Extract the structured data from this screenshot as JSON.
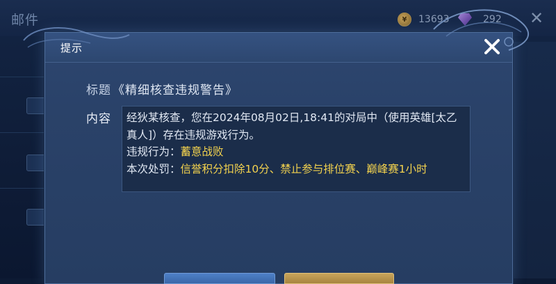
{
  "background": {
    "title": "邮件",
    "gold_amount": "13693",
    "gem_amount": "292"
  },
  "dialog": {
    "title": "提示",
    "subject_label": "标题",
    "subject": "《精细核查违规警告》",
    "content_label": "内容",
    "content": {
      "line1": "经狄某核查，您在2024年08月02日,18:41的对局中（使用英雄[太乙真人]）存在违规游戏行为。",
      "violation_label": "违规行为：",
      "violation_value": "蓄意战败",
      "penalty_label": "本次处罚：",
      "penalty_value": "信誉积分扣除10分、禁止参与排位赛、巅峰赛1小时"
    }
  },
  "colors": {
    "highlight": "#f3d24e",
    "dialog_bg": "#2a4269",
    "text": "#e1e8f3"
  },
  "icons": {
    "close": "close-icon",
    "gold": "gold-coin-icon",
    "gem": "gem-icon"
  }
}
